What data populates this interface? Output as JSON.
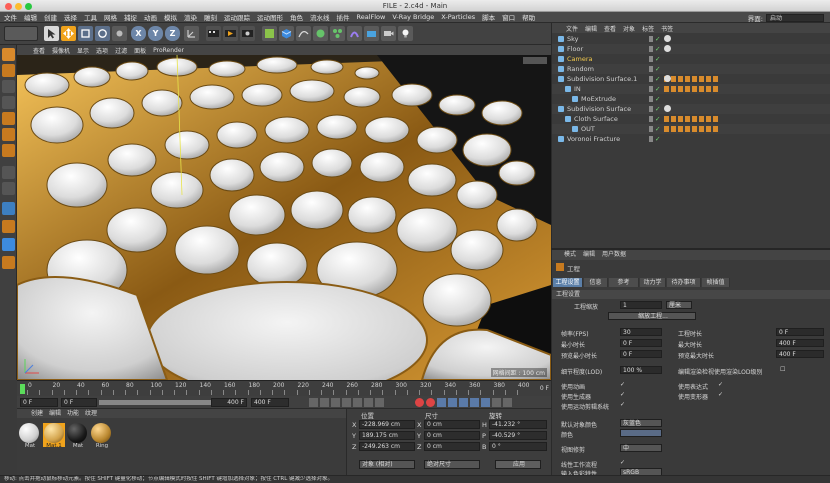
{
  "window": {
    "title": "FILE - 2.c4d - Main"
  },
  "menu": [
    "文件",
    "编辑",
    "创建",
    "选择",
    "工具",
    "网格",
    "捕捉",
    "动画",
    "模拟",
    "渲染",
    "雕刻",
    "运动跟踪",
    "运动图形",
    "角色",
    "流水线",
    "插件",
    "RealFlow",
    "V-Ray Bridge",
    "X-Particles",
    "脚本",
    "窗口",
    "帮助"
  ],
  "layout": {
    "label": "界面:",
    "value": "启动"
  },
  "toolbar": {
    "x_axis": "X",
    "y_axis": "Y",
    "z_axis": "Z"
  },
  "viewport": {
    "menu": [
      "查看",
      "摄像机",
      "显示",
      "选项",
      "过滤",
      "面板",
      "ProRender"
    ],
    "grid_label": "网格间距 : 100 cm"
  },
  "timeline": {
    "ticks": [
      "0",
      "10",
      "20",
      "30",
      "40",
      "50",
      "60",
      "70",
      "80",
      "90",
      "100",
      "110",
      "120",
      "130",
      "140",
      "150",
      "160",
      "170",
      "180",
      "190",
      "200",
      "210",
      "220",
      "230",
      "240",
      "250",
      "260",
      "270",
      "280",
      "290",
      "300",
      "310",
      "320",
      "330",
      "340",
      "350",
      "360",
      "370",
      "380",
      "390",
      "400"
    ],
    "end_frame": "0 F"
  },
  "transport": {
    "current_frame": "0 F",
    "start_frame": "0 F",
    "max_frame": "400 F",
    "end_frame": "400 F"
  },
  "materials": {
    "menu": [
      "创建",
      "编辑",
      "功能",
      "纹理"
    ],
    "items": [
      {
        "label": "Mat",
        "color": "#e8e8e8"
      },
      {
        "label": "Mat.1",
        "color": "#d2a24a",
        "selected": true
      },
      {
        "label": "Mat",
        "color": "#1a1a1a"
      },
      {
        "label": "Ring",
        "color": "#b8862e"
      }
    ]
  },
  "coordinates": {
    "headers": {
      "position": "位置",
      "size": "尺寸",
      "rotation": "旋转"
    },
    "rows": [
      {
        "axis": "X",
        "position": "-228.969 cm",
        "size_axis": "X",
        "size": "0 cm",
        "rot_axis": "H",
        "rotation": "-41.232 °"
      },
      {
        "axis": "Y",
        "position": "189.175 cm",
        "size_axis": "Y",
        "size": "0 cm",
        "rot_axis": "P",
        "rotation": "-40.529 °"
      },
      {
        "axis": "Z",
        "position": "-249.263 cm",
        "size_axis": "Z",
        "size": "0 cm",
        "rot_axis": "B",
        "rotation": "0 °"
      }
    ],
    "mode": "对象 (相对)",
    "size_mode": "绝对尺寸",
    "apply": "应用"
  },
  "object_manager": {
    "tabs": [
      "文件",
      "编辑",
      "查看",
      "对象",
      "标签",
      "书签"
    ],
    "objects": [
      {
        "name": "Sky",
        "indent": 0,
        "color": "#cfcfcf"
      },
      {
        "name": "Floor",
        "indent": 0,
        "color": "#cfcfcf"
      },
      {
        "name": "Camera",
        "indent": 0,
        "color": "#f2c94c"
      },
      {
        "name": "Random",
        "indent": 0,
        "color": "#cfcfcf"
      },
      {
        "name": "Subdivision Surface.1",
        "indent": 0,
        "color": "#cfcfcf"
      },
      {
        "name": "IN",
        "indent": 1,
        "color": "#cfcfcf"
      },
      {
        "name": "MoExtrude",
        "indent": 2,
        "color": "#cfcfcf"
      },
      {
        "name": "Subdivision Surface",
        "indent": 0,
        "color": "#cfcfcf"
      },
      {
        "name": "Cloth Surface",
        "indent": 1,
        "color": "#cfcfcf"
      },
      {
        "name": "OUT",
        "indent": 2,
        "color": "#cfcfcf"
      },
      {
        "name": "Voronoi Fracture",
        "indent": 0,
        "color": "#cfcfcf"
      }
    ]
  },
  "attributes": {
    "menu": [
      "模式",
      "编辑",
      "用户数据"
    ],
    "title": "工程",
    "tabs": [
      "工程设置",
      "信息",
      "参考",
      "动力学",
      "待办事项",
      "帧插值"
    ],
    "section": "工程设置",
    "project_scale_label": "工程缩放",
    "project_scale": "1",
    "project_scale_unit": "厘米",
    "scale_button": "缩放工程...",
    "fps_label": "帧率(FPS)",
    "fps": "30",
    "duration_label": "工程时长",
    "duration": "0 F",
    "min_time_label": "最小时长",
    "min_time": "0 F",
    "max_time_label": "最大时长",
    "max_time": "400 F",
    "preview_min_label": "预览最小时长",
    "preview_min": "0 F",
    "preview_max_label": "预览最大时长",
    "preview_max": "400 F",
    "lod_label": "细节程度(LOD)",
    "lod": "100 %",
    "lod_render": "编辑渲染检视使用渲染LOD级别",
    "use_animation": "使用动画",
    "use_expression": "使用表达式",
    "use_generators": "使用生成器",
    "use_deformers": "使用变形器",
    "use_motion_system": "使用运动剪辑系统",
    "default_color_label": "默认对象颜色",
    "default_color": "灰蓝色",
    "color_label": "颜色",
    "view_clip_label": "视图修剪",
    "view_clip": "中",
    "linear_workflow": "线性工作流程",
    "input_color_label": "输入色彩特性",
    "input_color": "sRGB"
  },
  "status": "移动: 点击并拖动鼠标移动元素。按住 SHIFT 键量化移动；节点编辑模式时按住 SHIFT 键增加选择对象；按住 CTRL 键减少选择对象。",
  "colors": {
    "accent": "#f0a31c",
    "selection": "#5b7fa8",
    "gold": "#b8862e"
  }
}
